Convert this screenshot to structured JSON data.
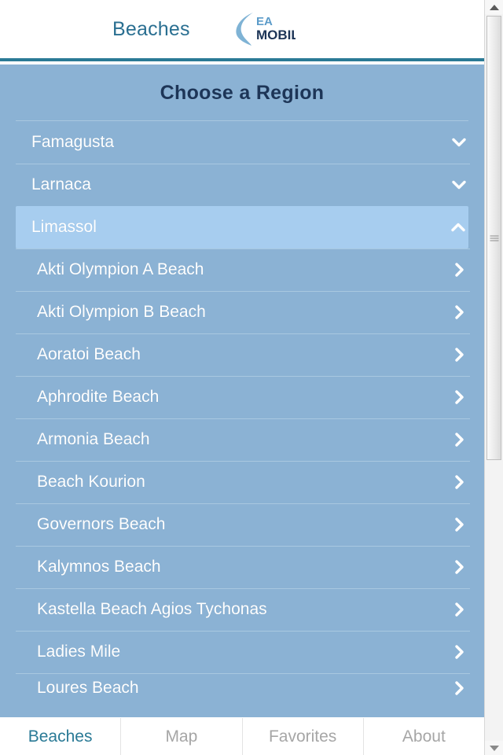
{
  "header": {
    "title": "Beaches",
    "logo": {
      "name": "sea-mobile-logo",
      "line1": "EA",
      "line2": "MOBILE"
    }
  },
  "main": {
    "page_title": "Choose a Region",
    "regions": [
      {
        "label": "Famagusta",
        "expanded": false,
        "icon": "chevron-down-icon"
      },
      {
        "label": "Larnaca",
        "expanded": false,
        "icon": "chevron-down-icon"
      },
      {
        "label": "Limassol",
        "expanded": true,
        "icon": "chevron-up-icon",
        "selected": true
      }
    ],
    "beaches": [
      {
        "label": "Akti Olympion A Beach",
        "icon": "chevron-right-icon"
      },
      {
        "label": "Akti Olympion B Beach",
        "icon": "chevron-right-icon"
      },
      {
        "label": "Aoratoi Beach",
        "icon": "chevron-right-icon"
      },
      {
        "label": "Aphrodite Beach",
        "icon": "chevron-right-icon"
      },
      {
        "label": "Armonia Beach",
        "icon": "chevron-right-icon"
      },
      {
        "label": "Beach Kourion",
        "icon": "chevron-right-icon"
      },
      {
        "label": "Governors Beach",
        "icon": "chevron-right-icon"
      },
      {
        "label": "Kalymnos Beach",
        "icon": "chevron-right-icon"
      },
      {
        "label": "Kastella Beach Agios Tychonas",
        "icon": "chevron-right-icon"
      },
      {
        "label": "Ladies Mile",
        "icon": "chevron-right-icon"
      },
      {
        "label": "Loures Beach",
        "icon": "chevron-right-icon"
      }
    ]
  },
  "tabbar": {
    "tabs": [
      {
        "label": "Beaches",
        "active": true
      },
      {
        "label": "Map",
        "active": false
      },
      {
        "label": "Favorites",
        "active": false
      },
      {
        "label": "About",
        "active": false
      }
    ]
  },
  "colors": {
    "accent_teal": "#2a7a96",
    "content_blue": "#8bb2d4",
    "selected_blue": "#a7cdef",
    "title_navy": "#1d3557",
    "separator": "#a9c8e0",
    "tab_inactive": "#a6a6a6"
  },
  "scrollbar": {
    "up_arrow": "scroll-up-arrow",
    "down_arrow": "scroll-down-arrow",
    "thumb": "scroll-thumb"
  }
}
